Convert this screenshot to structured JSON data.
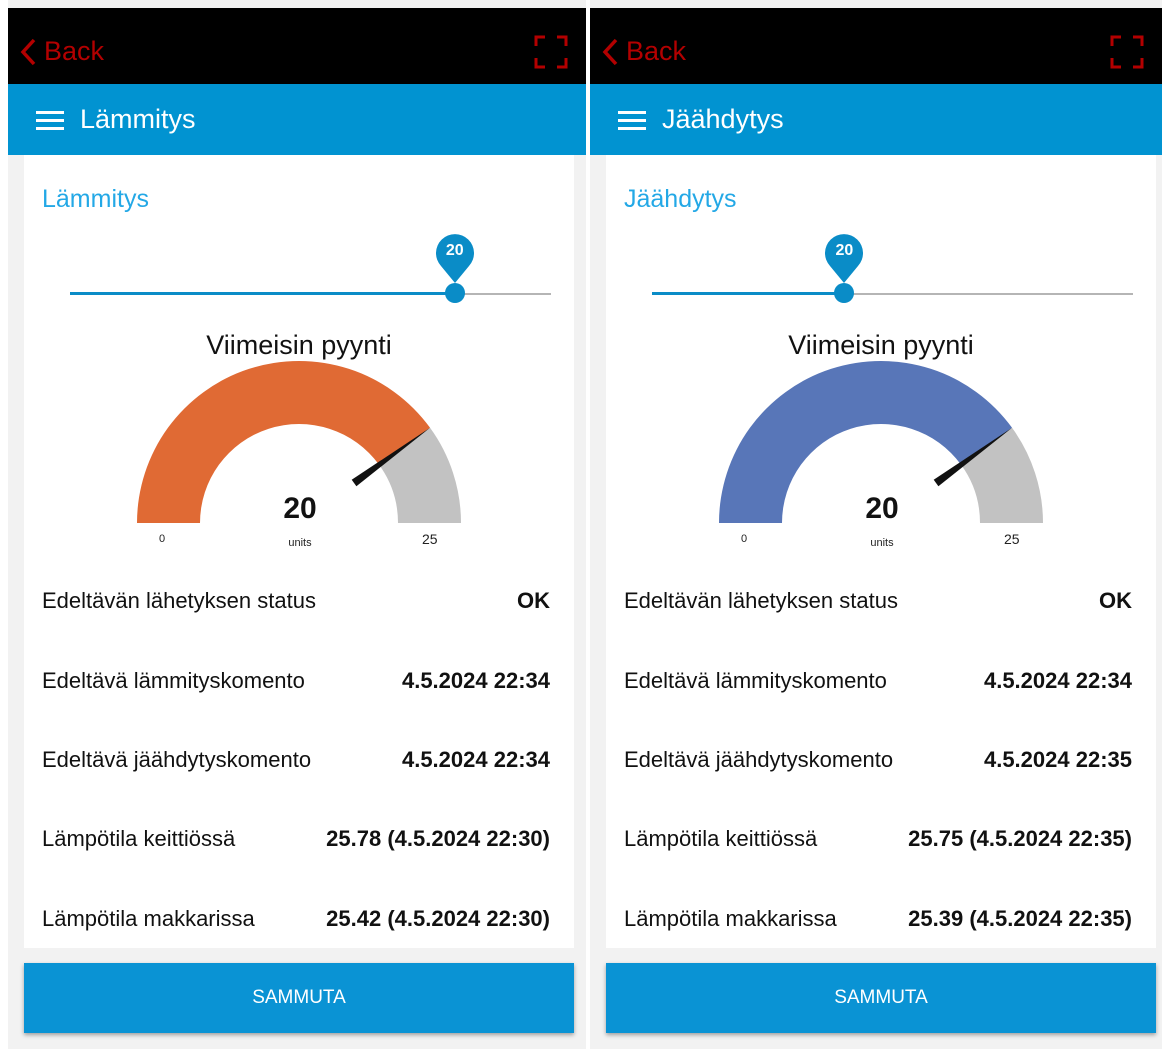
{
  "panels": [
    {
      "back_label": "Back",
      "appbar_title": "Lämmitys",
      "section_title": "Lämmitys",
      "slider": {
        "value": "20",
        "min": 0,
        "max": 25
      },
      "gauge": {
        "title": "Viimeisin pyynti",
        "value": "20",
        "units": "units",
        "min_label": "0",
        "max_label": "25",
        "fill_color": "#e06a34",
        "rest_color": "#c2c2c2"
      },
      "rows": [
        {
          "label": "Edeltävän lähetyksen status",
          "value": "OK"
        },
        {
          "label": "Edeltävä lämmityskomento",
          "value": "4.5.2024 22:34"
        },
        {
          "label": "Edeltävä jäähdytyskomento",
          "value": "4.5.2024 22:34"
        },
        {
          "label": "Lämpötila keittiössä",
          "value": "25.78 (4.5.2024 22:30)"
        },
        {
          "label": "Lämpötila makkarissa",
          "value": "25.42 (4.5.2024 22:30)"
        }
      ],
      "button_label": "SAMMUTA"
    },
    {
      "back_label": "Back",
      "appbar_title": "Jäähdytys",
      "section_title": "Jäähdytys",
      "slider": {
        "value": "20",
        "min": 0,
        "max": 50
      },
      "gauge": {
        "title": "Viimeisin pyynti",
        "value": "20",
        "units": "units",
        "min_label": "0",
        "max_label": "25",
        "fill_color": "#5876b8",
        "rest_color": "#c2c2c2"
      },
      "rows": [
        {
          "label": "Edeltävän lähetyksen status",
          "value": "OK"
        },
        {
          "label": "Edeltävä lämmityskomento",
          "value": "4.5.2024 22:34"
        },
        {
          "label": "Edeltävä jäähdytyskomento",
          "value": "4.5.2024 22:35"
        },
        {
          "label": "Lämpötila keittiössä",
          "value": "25.75 (4.5.2024 22:35)"
        },
        {
          "label": "Lämpötila makkarissa",
          "value": "25.39 (4.5.2024 22:35)"
        }
      ],
      "button_label": "SAMMUTA"
    }
  ],
  "colors": {
    "topbar": "#000000",
    "appbar": "#0193d1",
    "back_red": "#b30000",
    "section_title": "#23a8e6",
    "button": "#0a93d4"
  },
  "icons": {
    "back": "chevron-left-icon",
    "fullscreen": "fullscreen-icon",
    "menu": "hamburger-menu-icon"
  }
}
